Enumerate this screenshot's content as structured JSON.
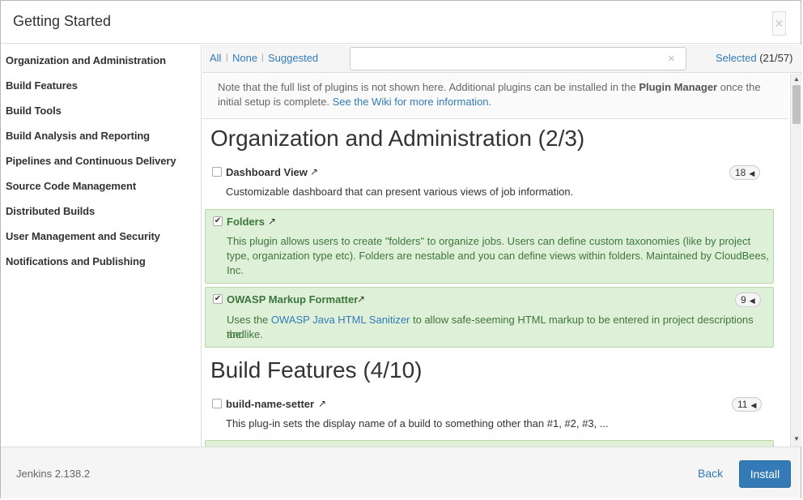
{
  "dialog": {
    "title": "Getting Started",
    "close_glyph": "×"
  },
  "sidebar": {
    "items": [
      {
        "label": "Organization and Administration"
      },
      {
        "label": "Build Features"
      },
      {
        "label": "Build Tools"
      },
      {
        "label": "Build Analysis and Reporting"
      },
      {
        "label": "Pipelines and Continuous Delivery"
      },
      {
        "label": "Source Code Management"
      },
      {
        "label": "Distributed Builds"
      },
      {
        "label": "User Management and Security"
      },
      {
        "label": "Notifications and Publishing"
      }
    ]
  },
  "toolbar": {
    "all_label": "All",
    "none_label": "None",
    "suggested_label": "Suggested",
    "separator": "|",
    "search_value": "",
    "search_clear_glyph": "×",
    "selected_label": "Selected",
    "selected_count": "(21/57)"
  },
  "note": {
    "text_before": "Note that the full list of plugins is not shown here. Additional plugins can be installed in the ",
    "bold": "Plugin Manager",
    "text_after": " once the initial setup is complete. ",
    "link": "See the Wiki for more information."
  },
  "sections": [
    {
      "heading": "Organization and Administration (2/3)",
      "plugins": [
        {
          "name": "Dashboard View",
          "checked": false,
          "badge": "18",
          "description": "Customizable dashboard that can present various views of job information."
        },
        {
          "name": "Folders",
          "checked": true,
          "badge": "",
          "description_line1": "This plugin allows users to create \"folders\" to organize jobs. Users can define custom taxonomies (like by project",
          "description_line2": "type, organization type etc). Folders are nestable and you can define views within folders. Maintained by CloudBees,",
          "description_line3": "Inc."
        },
        {
          "name": "OWASP Markup Formatter",
          "checked": true,
          "badge": "9",
          "description_before": "Uses the ",
          "description_link": "OWASP Java HTML Sanitizer",
          "description_after": " to allow safe-seeming HTML markup to be entered in project descriptions and",
          "description_line2": "the like."
        }
      ]
    },
    {
      "heading": "Build Features (4/10)",
      "plugins": [
        {
          "name": "build-name-setter",
          "checked": false,
          "badge": "11",
          "description": "This plug-in sets the display name of a build to something other than #1, #2, #3, ..."
        }
      ]
    }
  ],
  "icons": {
    "external_link": "↗",
    "badge_arrow": "◀",
    "checkmark": "✔",
    "scroll_up": "▲",
    "scroll_down": "▼"
  },
  "colors": {
    "accent": "#337ab7",
    "selected_bg": "#dff0d8",
    "selected_text": "#3c763d"
  },
  "footer": {
    "version": "Jenkins 2.138.2",
    "back_label": "Back",
    "install_label": "Install"
  }
}
